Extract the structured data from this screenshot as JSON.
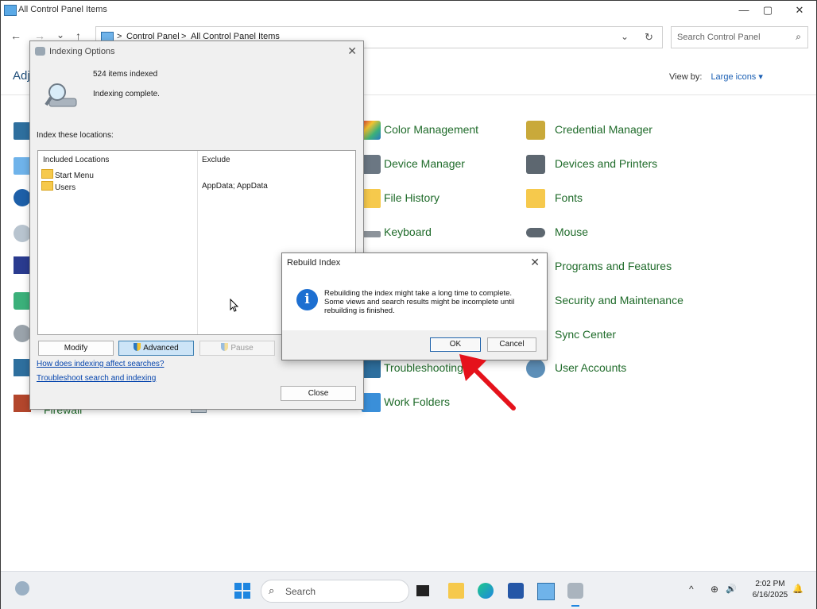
{
  "window": {
    "title": "All Control Panel Items",
    "minimize": "—",
    "maximize": "▢",
    "close": "✕"
  },
  "nav": {
    "back": "←",
    "forward": "→",
    "recent": "⌄",
    "up": "↑",
    "breadcrumb_sep": ">",
    "breadcrumb": [
      "Control Panel",
      "All Control Panel Items"
    ],
    "dropdown": "⌄",
    "refresh": "↻",
    "search_placeholder": "Search Control Panel",
    "search_icon": "⌕"
  },
  "header": {
    "heading_partial": "Adj",
    "view_by_label": "View by:",
    "view_by_value": "Large icons ▾"
  },
  "items_col2": [
    {
      "label": "Color Management",
      "icon": "color-management-icon"
    },
    {
      "label": "Device Manager",
      "icon": "device-manager-icon"
    },
    {
      "label": "File History",
      "icon": "file-history-icon"
    },
    {
      "label": "Keyboard",
      "icon": "keyboard-icon"
    },
    {
      "label": "Troubleshooting",
      "icon": "troubleshooting-icon"
    },
    {
      "label": "Work Folders",
      "icon": "work-folders-icon"
    }
  ],
  "items_col3": [
    {
      "label": "Credential Manager",
      "icon": "credential-manager-icon"
    },
    {
      "label": "Devices and Printers",
      "icon": "devices-printers-icon"
    },
    {
      "label": "Fonts",
      "icon": "fonts-icon"
    },
    {
      "label": "Mouse",
      "icon": "mouse-icon"
    },
    {
      "label": "Programs and Features",
      "icon": "programs-features-icon"
    },
    {
      "label": "Security and Maintenance",
      "icon": "security-maintenance-icon"
    },
    {
      "label": "Sync Center",
      "icon": "sync-center-icon"
    },
    {
      "label": "User Accounts",
      "icon": "user-accounts-icon"
    }
  ],
  "items_col1_partial": {
    "firewall_label": "Firewall"
  },
  "indexing_dialog": {
    "title": "Indexing Options",
    "close": "✕",
    "items_indexed": "524 items indexed",
    "status": "Indexing complete.",
    "locations_label": "Index these locations:",
    "col_included": "Included Locations",
    "col_exclude": "Exclude",
    "locations": [
      {
        "name": "Start Menu",
        "exclude": ""
      },
      {
        "name": "Users",
        "exclude": "AppData; AppData"
      }
    ],
    "buttons": {
      "modify": "Modify",
      "advanced": "Advanced",
      "pause": "Pause",
      "close": "Close"
    },
    "links": {
      "how_indexing": "How does indexing affect searches?",
      "troubleshoot": "Troubleshoot search and indexing"
    }
  },
  "rebuild_dialog": {
    "title": "Rebuild Index",
    "close": "✕",
    "info_glyph": "i",
    "message": "Rebuilding the index might take a long time to complete. Some views and search results might be incomplete until rebuilding is finished.",
    "ok": "OK",
    "cancel": "Cancel"
  },
  "taskbar": {
    "search_placeholder": "Search",
    "search_icon": "⌕",
    "tray_chevron": "^",
    "tray_network": "⊕",
    "tray_volume": "🔊",
    "tray_bell": "🔔",
    "time": "2:02 PM",
    "date": "6/16/2025"
  },
  "colors": {
    "link_green": "#1f6b2a",
    "accent_blue": "#1a5fb4",
    "arrow_red": "#e5121b"
  }
}
